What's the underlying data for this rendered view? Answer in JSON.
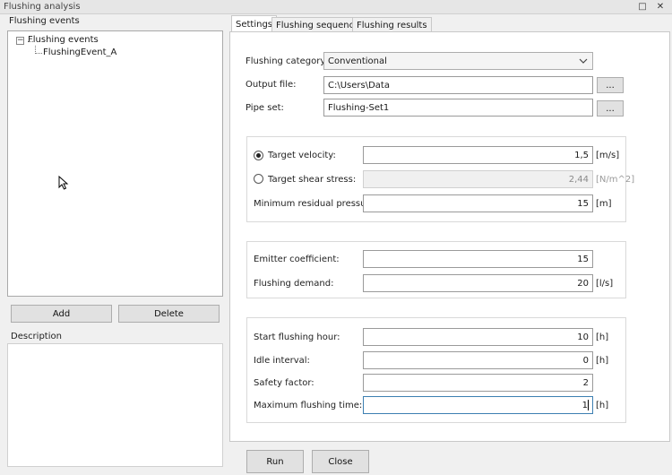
{
  "window": {
    "title": "Flushing analysis",
    "maximize_glyph": "□",
    "close_glyph": "✕"
  },
  "left": {
    "events_label": "Flushing events",
    "tree": {
      "root_label": "Flushing events",
      "root_toggle_glyph": "−",
      "child_label": "FlushingEvent_A"
    },
    "add_label": "Add",
    "delete_label": "Delete",
    "description_label": "Description",
    "description_value": ""
  },
  "tabs": [
    {
      "label": "Settings",
      "active": true
    },
    {
      "label": "Flushing sequence",
      "active": false
    },
    {
      "label": "Flushing results",
      "active": false
    }
  ],
  "settings": {
    "category": {
      "label": "Flushing category:",
      "value": "Conventional"
    },
    "output_file": {
      "label": "Output file:",
      "value": "C:\\Users\\Data",
      "browse": "..."
    },
    "pipe_set": {
      "label": "Pipe set:",
      "value": "Flushing-Set1",
      "browse": "..."
    },
    "target_velocity": {
      "label": "Target velocity:",
      "value": "1,5",
      "unit": "[m/s]",
      "selected": true
    },
    "target_shear": {
      "label": "Target shear stress:",
      "value": "2,44",
      "unit": "[N/m^2]",
      "selected": false
    },
    "min_pressure": {
      "label": "Minimum residual pressure:",
      "value": "15",
      "unit": "[m]"
    },
    "emitter": {
      "label": "Emitter coefficient:",
      "value": "15"
    },
    "demand": {
      "label": "Flushing demand:",
      "value": "20",
      "unit": "[l/s]"
    },
    "start_hour": {
      "label": "Start flushing hour:",
      "value": "10",
      "unit": "[h]"
    },
    "idle": {
      "label": "Idle interval:",
      "value": "0",
      "unit": "[h]"
    },
    "safety": {
      "label": "Safety factor:",
      "value": "2"
    },
    "max_time": {
      "label": "Maximum flushing time:",
      "value": "1",
      "unit": "[h]"
    }
  },
  "footer": {
    "run_label": "Run",
    "close_label": "Close"
  },
  "colors": {
    "accent_focus": "#3c7fb1",
    "window_bg": "#f0f0f0"
  },
  "icons": {
    "dropdown": "chevron-down-icon",
    "cursor": "mouse-pointer-icon"
  }
}
